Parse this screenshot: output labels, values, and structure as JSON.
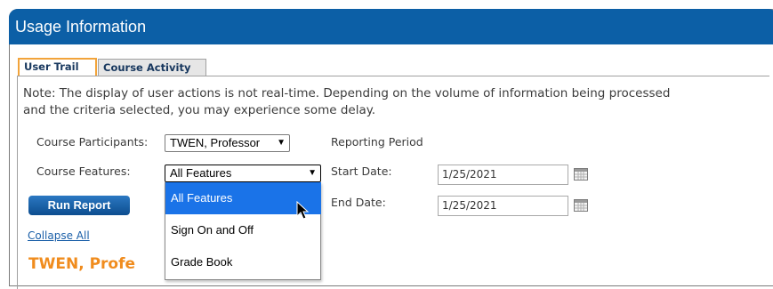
{
  "window": {
    "title": "Usage Information"
  },
  "tabs": [
    {
      "label": "User Trail",
      "active": true
    },
    {
      "label": "Course Activity",
      "active": false
    }
  ],
  "note": {
    "line1": "Note: The display of user actions is not real-time. Depending on the volume of information being processed",
    "line2": "and the criteria selected, you may experience some delay."
  },
  "form": {
    "participants_label": "Course Participants:",
    "participants_value": "TWEN, Professor",
    "features_label": "Course Features:",
    "features_value": "All Features",
    "reporting_period_label": "Reporting Period",
    "start_date_label": "Start Date:",
    "start_date_value": "1/25/2021",
    "end_date_label": "End Date:",
    "end_date_value": "1/25/2021",
    "run_report_label": "Run Report",
    "collapse_all_label": "Collapse All",
    "person_heading": "TWEN, Profe"
  },
  "dropdown": {
    "options": [
      "All Features",
      "Sign On and Off",
      "Grade Book"
    ],
    "selected_index": 0
  },
  "colors": {
    "title_bar": "#0c5fa6",
    "active_tab_border": "#f2a43b",
    "selected_option": "#1a73e8",
    "heading_orange": "#f08c1e"
  }
}
